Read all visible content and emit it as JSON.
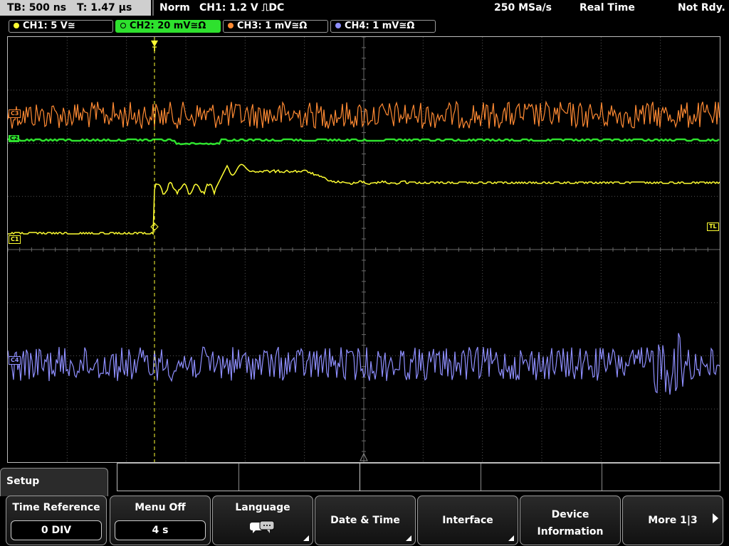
{
  "topbar": {
    "timebase": "TB: 500 ns",
    "trigger_time": "T: 1.47 µs",
    "mode": "Norm",
    "trigger": "CH1: 1.2 V ⎍DC",
    "sample_rate": "250 MSa/s",
    "acq_mode": "Real Time",
    "status": "Not Rdy."
  },
  "channels": [
    {
      "label": "CH1: 5 V≅",
      "color": "#ffff33"
    },
    {
      "label": "CH2: 20 mV≅Ω",
      "color": "#2ee12e"
    },
    {
      "label": "CH3: 1 mV≅Ω",
      "color": "#ff8a33"
    },
    {
      "label": "CH4: 1 mV≅Ω",
      "color": "#8f8fff"
    }
  ],
  "markers": {
    "c1": "C1",
    "c2": "C2",
    "c3": "C3",
    "c4": "C4",
    "trigger_level": "TL",
    "trigger_pos": "T"
  },
  "menu": {
    "title": "Setup",
    "softkeys": [
      {
        "label": "Time Reference",
        "value": "0 DIV"
      },
      {
        "label": "Menu Off",
        "value": "4 s"
      },
      {
        "label": "Language",
        "icon": "speech-bubbles-icon"
      },
      {
        "label": "Date & Time"
      },
      {
        "label": "Interface"
      },
      {
        "label": "Device",
        "label2": "Information"
      },
      {
        "label": "More 1|3"
      }
    ]
  },
  "chart_data": {
    "type": "line",
    "title": "",
    "grid": true,
    "grid_divisions": {
      "x": 12,
      "y": 8
    },
    "series": [
      {
        "name": "CH1",
        "color": "#ffff33"
      },
      {
        "name": "CH2",
        "color": "#2ee12e"
      },
      {
        "name": "CH3",
        "color": "#ff8a33"
      },
      {
        "name": "CH4",
        "color": "#8f8fff"
      }
    ]
  }
}
